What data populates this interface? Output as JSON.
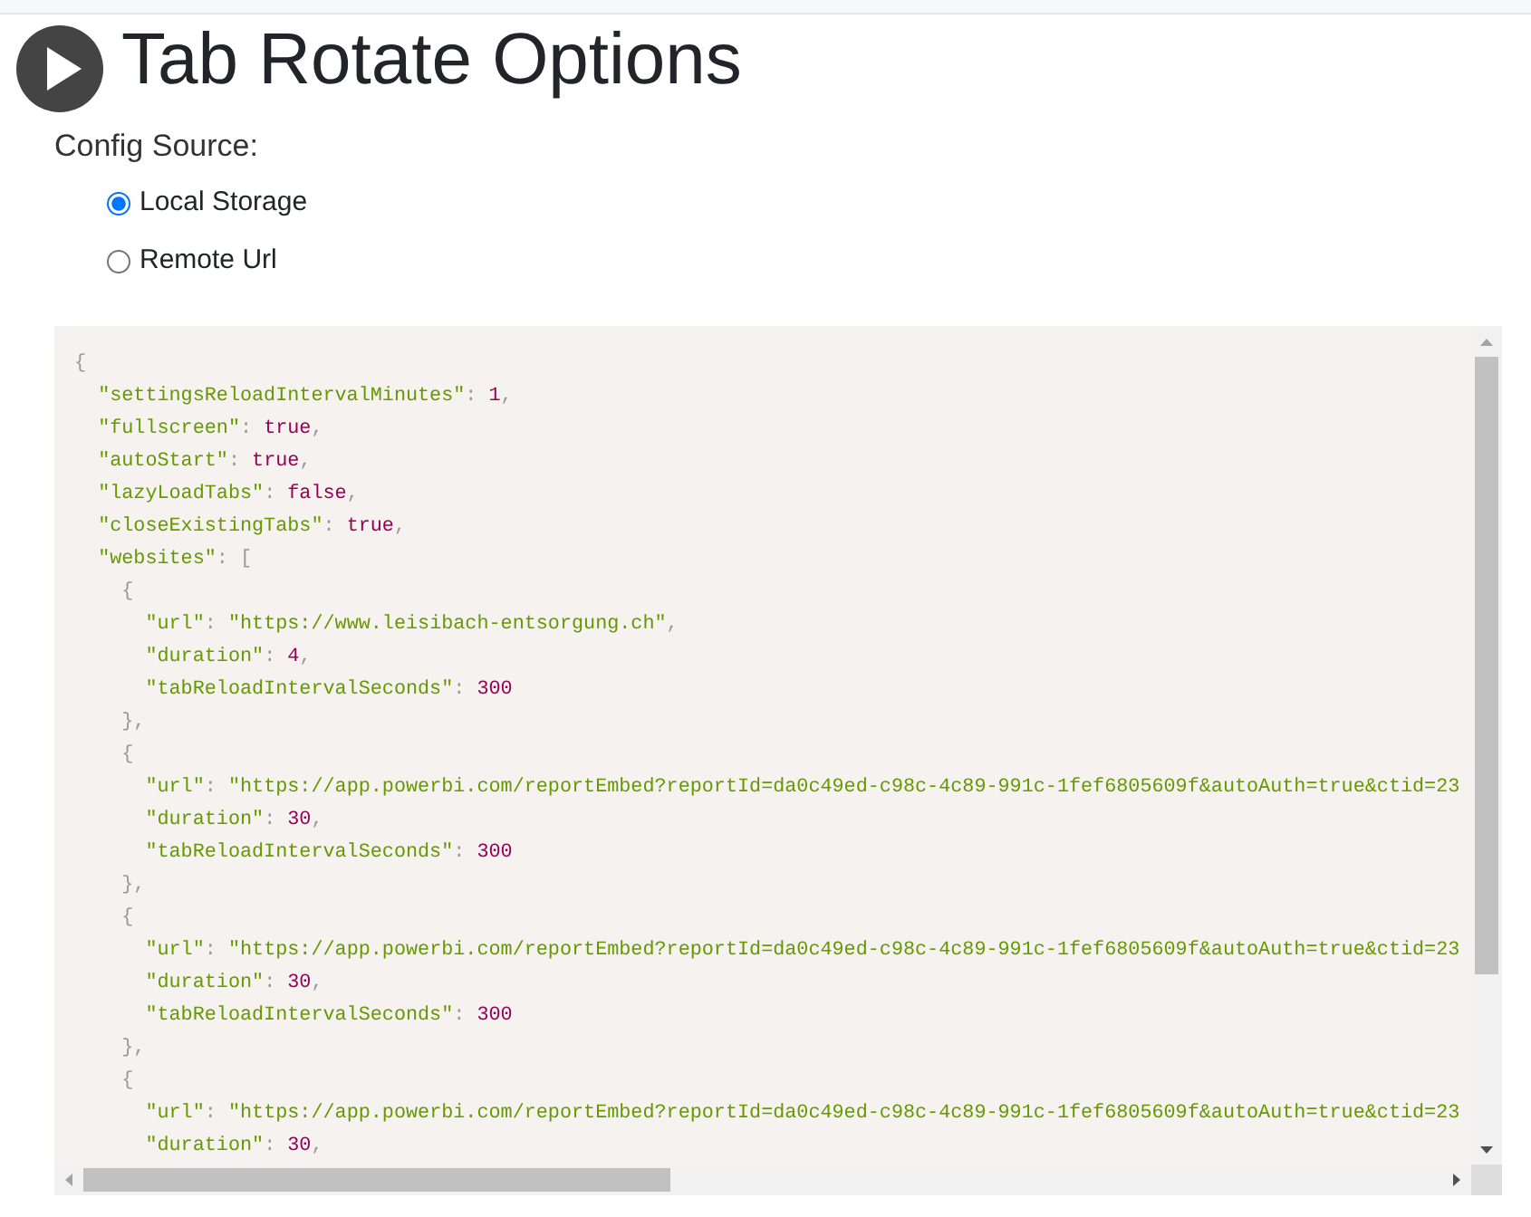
{
  "header": {
    "title": "Tab Rotate Options"
  },
  "config_source": {
    "label": "Config Source:",
    "options": [
      {
        "label": "Local Storage",
        "selected": true
      },
      {
        "label": "Remote Url",
        "selected": false
      }
    ]
  },
  "editor": {
    "code": {
      "kind": "block",
      "open": [
        {
          "kind": "punct",
          "text": "{"
        }
      ],
      "children": [
        {
          "kind": "line",
          "tokens": [
            {
              "kind": "key",
              "text": "\"settingsReloadIntervalMinutes\""
            },
            {
              "kind": "punct",
              "text": ": "
            },
            {
              "kind": "number",
              "text": "1"
            },
            {
              "kind": "punct",
              "text": ","
            }
          ]
        },
        {
          "kind": "line",
          "tokens": [
            {
              "kind": "key",
              "text": "\"fullscreen\""
            },
            {
              "kind": "punct",
              "text": ": "
            },
            {
              "kind": "boolean",
              "text": "true"
            },
            {
              "kind": "punct",
              "text": ","
            }
          ]
        },
        {
          "kind": "line",
          "tokens": [
            {
              "kind": "key",
              "text": "\"autoStart\""
            },
            {
              "kind": "punct",
              "text": ": "
            },
            {
              "kind": "boolean",
              "text": "true"
            },
            {
              "kind": "punct",
              "text": ","
            }
          ]
        },
        {
          "kind": "line",
          "tokens": [
            {
              "kind": "key",
              "text": "\"lazyLoadTabs\""
            },
            {
              "kind": "punct",
              "text": ": "
            },
            {
              "kind": "boolean",
              "text": "false"
            },
            {
              "kind": "punct",
              "text": ","
            }
          ]
        },
        {
          "kind": "line",
          "tokens": [
            {
              "kind": "key",
              "text": "\"closeExistingTabs\""
            },
            {
              "kind": "punct",
              "text": ": "
            },
            {
              "kind": "boolean",
              "text": "true"
            },
            {
              "kind": "punct",
              "text": ","
            }
          ]
        },
        {
          "kind": "block",
          "open": [
            {
              "kind": "key",
              "text": "\"websites\""
            },
            {
              "kind": "punct",
              "text": ": ["
            }
          ],
          "children": [
            {
              "kind": "block",
              "open": [
                {
                  "kind": "punct",
                  "text": "{"
                }
              ],
              "children": [
                {
                  "kind": "line",
                  "tokens": [
                    {
                      "kind": "key",
                      "text": "\"url\""
                    },
                    {
                      "kind": "punct",
                      "text": ": "
                    },
                    {
                      "kind": "string",
                      "text": "\"https://www.leisibach-entsorgung.ch\""
                    },
                    {
                      "kind": "punct",
                      "text": ","
                    }
                  ]
                },
                {
                  "kind": "line",
                  "tokens": [
                    {
                      "kind": "key",
                      "text": "\"duration\""
                    },
                    {
                      "kind": "punct",
                      "text": ": "
                    },
                    {
                      "kind": "number",
                      "text": "4"
                    },
                    {
                      "kind": "punct",
                      "text": ","
                    }
                  ]
                },
                {
                  "kind": "line",
                  "tokens": [
                    {
                      "kind": "key",
                      "text": "\"tabReloadIntervalSeconds\""
                    },
                    {
                      "kind": "punct",
                      "text": ": "
                    },
                    {
                      "kind": "number",
                      "text": "300"
                    }
                  ]
                }
              ],
              "close": [
                {
                  "kind": "punct",
                  "text": "},"
                }
              ]
            },
            {
              "kind": "block",
              "open": [
                {
                  "kind": "punct",
                  "text": "{"
                }
              ],
              "children": [
                {
                  "kind": "line",
                  "tokens": [
                    {
                      "kind": "key",
                      "text": "\"url\""
                    },
                    {
                      "kind": "punct",
                      "text": ": "
                    },
                    {
                      "kind": "string",
                      "text": "\"https://app.powerbi.com/reportEmbed?reportId=da0c49ed-c98c-4c89-991c-1fef6805609f&autoAuth=true&ctid=23"
                    }
                  ]
                },
                {
                  "kind": "line",
                  "tokens": [
                    {
                      "kind": "key",
                      "text": "\"duration\""
                    },
                    {
                      "kind": "punct",
                      "text": ": "
                    },
                    {
                      "kind": "number",
                      "text": "30"
                    },
                    {
                      "kind": "punct",
                      "text": ","
                    }
                  ]
                },
                {
                  "kind": "line",
                  "tokens": [
                    {
                      "kind": "key",
                      "text": "\"tabReloadIntervalSeconds\""
                    },
                    {
                      "kind": "punct",
                      "text": ": "
                    },
                    {
                      "kind": "number",
                      "text": "300"
                    }
                  ]
                }
              ],
              "close": [
                {
                  "kind": "punct",
                  "text": "},"
                }
              ]
            },
            {
              "kind": "block",
              "open": [
                {
                  "kind": "punct",
                  "text": "{"
                }
              ],
              "children": [
                {
                  "kind": "line",
                  "tokens": [
                    {
                      "kind": "key",
                      "text": "\"url\""
                    },
                    {
                      "kind": "punct",
                      "text": ": "
                    },
                    {
                      "kind": "string",
                      "text": "\"https://app.powerbi.com/reportEmbed?reportId=da0c49ed-c98c-4c89-991c-1fef6805609f&autoAuth=true&ctid=23"
                    }
                  ]
                },
                {
                  "kind": "line",
                  "tokens": [
                    {
                      "kind": "key",
                      "text": "\"duration\""
                    },
                    {
                      "kind": "punct",
                      "text": ": "
                    },
                    {
                      "kind": "number",
                      "text": "30"
                    },
                    {
                      "kind": "punct",
                      "text": ","
                    }
                  ]
                },
                {
                  "kind": "line",
                  "tokens": [
                    {
                      "kind": "key",
                      "text": "\"tabReloadIntervalSeconds\""
                    },
                    {
                      "kind": "punct",
                      "text": ": "
                    },
                    {
                      "kind": "number",
                      "text": "300"
                    }
                  ]
                }
              ],
              "close": [
                {
                  "kind": "punct",
                  "text": "},"
                }
              ]
            },
            {
              "kind": "block",
              "open": [
                {
                  "kind": "punct",
                  "text": "{"
                }
              ],
              "children": [
                {
                  "kind": "line",
                  "tokens": [
                    {
                      "kind": "key",
                      "text": "\"url\""
                    },
                    {
                      "kind": "punct",
                      "text": ": "
                    },
                    {
                      "kind": "string",
                      "text": "\"https://app.powerbi.com/reportEmbed?reportId=da0c49ed-c98c-4c89-991c-1fef6805609f&autoAuth=true&ctid=23"
                    }
                  ]
                },
                {
                  "kind": "line",
                  "tokens": [
                    {
                      "kind": "key",
                      "text": "\"duration\""
                    },
                    {
                      "kind": "punct",
                      "text": ": "
                    },
                    {
                      "kind": "number",
                      "text": "30"
                    },
                    {
                      "kind": "punct",
                      "text": ","
                    }
                  ]
                }
              ]
            }
          ]
        }
      ]
    }
  }
}
